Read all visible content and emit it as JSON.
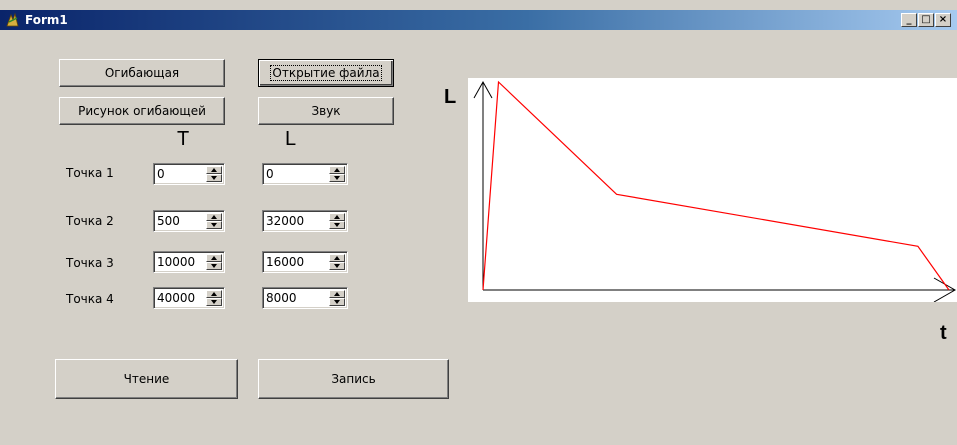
{
  "window": {
    "title": "Form1",
    "minimize": "_",
    "maximize": "□",
    "close": "×"
  },
  "buttons": {
    "envelope": "Огибающая",
    "open_file": "Открытие файла",
    "draw_envelope": "Рисунок огибающей",
    "sound": "Звук",
    "read": "Чтение",
    "write": "Запись"
  },
  "headers": {
    "t": "T",
    "l": "L"
  },
  "points": [
    {
      "label": "Точка 1",
      "t": "0",
      "l": "0"
    },
    {
      "label": "Точка 2",
      "t": "500",
      "l": "32000"
    },
    {
      "label": "Точка 3",
      "t": "10000",
      "l": "16000"
    },
    {
      "label": "Точка 4",
      "t": "40000",
      "l": "8000"
    }
  ],
  "graph": {
    "y_axis_label": "L",
    "x_axis_label": "t",
    "line_color": "#ff0000"
  },
  "chart_data": {
    "type": "line",
    "x": [
      0,
      1,
      8.6,
      28,
      30
    ],
    "y": [
      0,
      100,
      46,
      21,
      0
    ],
    "xlabel": "t",
    "ylabel": "L"
  }
}
